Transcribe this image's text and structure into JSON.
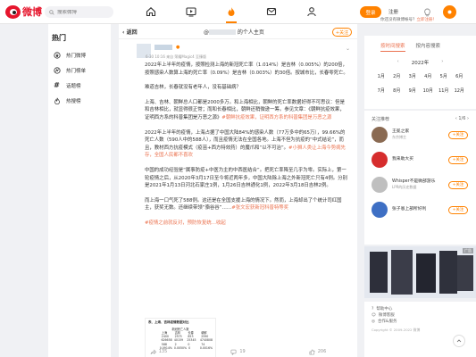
{
  "brand": {
    "name": "微博",
    "accent": "#ff8200",
    "red": "#e6162d"
  },
  "search": {
    "placeholder": "搜索微博"
  },
  "nav": [
    "home-icon",
    "video-icon",
    "hot-icon",
    "message-icon",
    "profile-icon"
  ],
  "header": {
    "login": "登录",
    "register": "注册"
  },
  "hint": {
    "prefix": "你还没有微博帐号？",
    "link": "立即注册！"
  },
  "sidebar": {
    "title": "热门",
    "items": [
      {
        "label": "热门微博",
        "icon": "hot-post-icon"
      },
      {
        "label": "热门榜单",
        "icon": "ranking-icon"
      },
      {
        "label": "话题榜",
        "icon": "topic-icon"
      },
      {
        "label": "热搜榜",
        "icon": "search-rank-icon"
      }
    ]
  },
  "main": {
    "back": "返回",
    "title_prefix": "@",
    "title_suffix": "的个人主页",
    "follow": "+关注",
    "meta": "6-30 10:16 来自 荣耀Magic4 至臻版",
    "paragraphs": [
      {
        "text": "2022年上半年的疫情，按照检测上海的新冠死亡率（1.014%）是吉林（0.005%）的200倍，按照感染人数算上海的死亡率（0.09%）是吉林（0.003%）的30倍。按城市比，长春零死亡。",
        "link": ""
      },
      {
        "text": "难道吉林，长春就没有老年人，没有基础病？",
        "link": ""
      },
      {
        "text": "上海、吉林、朝鲜总人口都是2000多万。和上海相比，朝鲜的死亡率数据好得不可思议：但是和吉林相比，就显得很正常；而和长春相比，朝鲜还稍微逊一筹。参见文章：《朝鲜抗疫效果，证明西方系的科普集团是万恶之源》",
        "link": "#朝鲜抗疫效果，证明西方系的科普集团是万恶之源"
      },
      {
        "text": "2022年上半年的疫情，上海占据了中国大陆84%的感染人数（77万多中的65万），99.66%的死亡人数（590人中的588人），而且疫情无法在全国各地。上海不但为抗疫的“中式结论”，而且，教材西方抗疫模式（疫苗+西方特效药）的魔爪和“以不可治”。",
        "link": "#小狮人类让上海今势病先存，全国人民都不喜欢"
      },
      {
        "text": "中国的成功经验是“属事防疫+中医为主的中西医结合”。把死亡率降至几乎为零。实际上，第一轮疫情之后，从2020年3月17日至今将近两年多，中国大陆除上海之外新冠死亡只有4例。分别是2021年1月13日河北石家庄1例，1月26日吉林通化1例，2022年3月18日吉林2例。",
        "link": ""
      },
      {
        "text": "而上海一口气死了588例。这还是在全国支援上海的情况下。然而，上海却出了个统计司红国主，获奖无数。还继续带领“骆谷谷”……",
        "link": "#张文宏获新冠科普特等奖"
      },
      {
        "text": "",
        "link": "#疫情之前就反对，预防恢复统…收起"
      }
    ],
    "table": {
      "title": "表、上海、吉林疫情数据对比",
      "subtitle": "新冠死亡人数",
      "headers": [
        "",
        "上海",
        "吉林",
        "长春",
        "朝鲜"
      ],
      "rows": [
        [
          "",
          "2400",
          "2575",
          "853",
          "2590"
        ],
        [
          "",
          "626658",
          "40159",
          "25345",
          "4740808"
        ],
        [
          "",
          "588",
          "2",
          "0",
          "74"
        ],
        [
          "",
          "0.0914%",
          "0.0050%",
          "0",
          "0.0016%"
        ]
      ]
    },
    "actions": {
      "share": "135",
      "comment": "19",
      "like": "206"
    }
  },
  "calendar": {
    "tabs": [
      "按时间搜索",
      "按内容搜索"
    ],
    "year": "2022年",
    "months": [
      "1月",
      "2月",
      "3月",
      "4月",
      "5月",
      "6月",
      "7月",
      "8月",
      "9月",
      "10月",
      "11月",
      "12月"
    ]
  },
  "recommend": {
    "title": "关注推荐",
    "page": "1/6",
    "follow": "+关注",
    "items": [
      {
        "name": "王冕之家",
        "desc": "东京博主",
        "color": "#8a6a52"
      },
      {
        "name": "我来助大买",
        "desc": "",
        "color": "#d62d2d"
      },
      {
        "name": "Whisper不是微部游乐",
        "desc": "LPR的历史数据",
        "color": "#bfbfbf"
      },
      {
        "name": "张子恩上部所好利",
        "desc": "",
        "color": "#3e6fc4"
      }
    ]
  },
  "ad": {
    "label": "广告"
  },
  "help": {
    "items": [
      "帮助中心",
      "微博客服",
      "合作&服务"
    ],
    "footer": "Copyright © 2009-2022 微博"
  }
}
